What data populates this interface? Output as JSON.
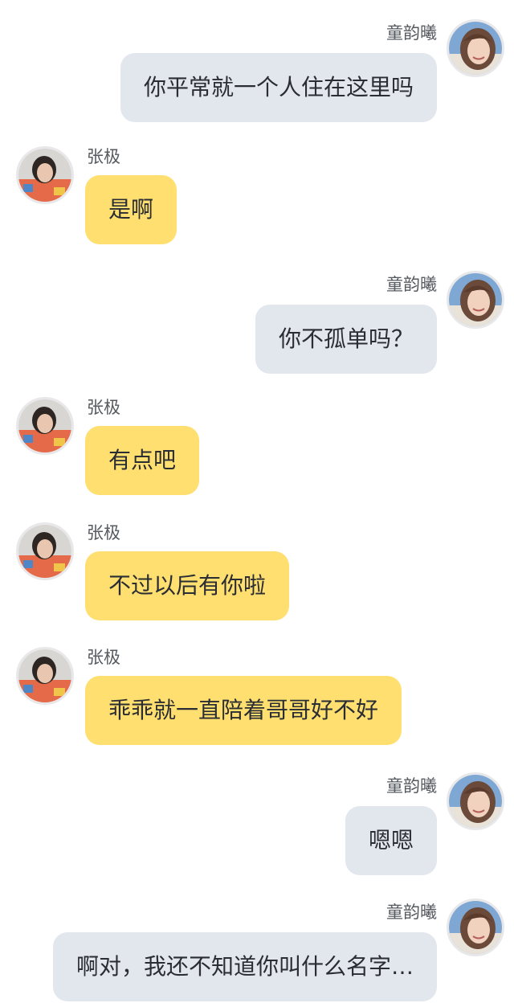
{
  "colors": {
    "self_bubble": "#e2e6ed",
    "other_bubble": "#ffdf6f",
    "background": "#ffffff"
  },
  "contacts": {
    "self_name": "童韵曦",
    "other_name": "张极"
  },
  "messages": [
    {
      "sender": "童韵曦",
      "text": "你平常就一个人住在这里吗"
    },
    {
      "sender": "张极",
      "text": "是啊"
    },
    {
      "sender": "童韵曦",
      "text": "你不孤单吗？"
    },
    {
      "sender": "张极",
      "text": "有点吧"
    },
    {
      "sender": "张极",
      "text": "不过以后有你啦"
    },
    {
      "sender": "张极",
      "text": "乖乖就一直陪着哥哥好不好"
    },
    {
      "sender": "童韵曦",
      "text": "嗯嗯"
    },
    {
      "sender": "童韵曦",
      "text": "啊对，我还不知道你叫什么名字…"
    }
  ],
  "icons": {
    "self_avatar": "girl-avatar-icon",
    "other_avatar": "boy-avatar-icon"
  }
}
